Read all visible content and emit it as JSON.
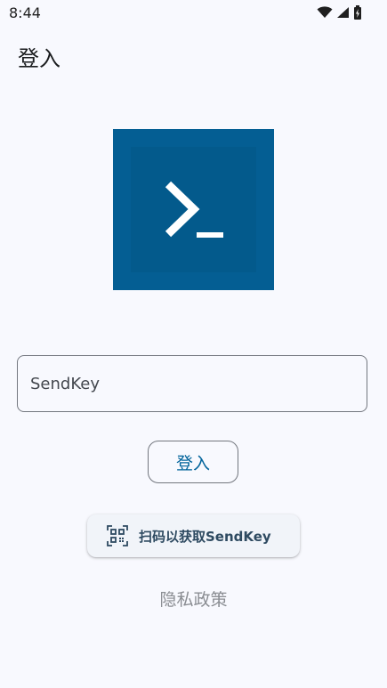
{
  "status_bar": {
    "time": "8:44",
    "icons": [
      "wifi-icon",
      "cellular-signal-icon",
      "battery-icon"
    ]
  },
  "app_bar": {
    "title": "登入"
  },
  "logo": {
    "icon": "terminal-prompt-icon",
    "color": "#045e93"
  },
  "form": {
    "sendkey_placeholder": "SendKey",
    "sendkey_value": "",
    "login_label": "登入",
    "scan_label": "扫码以获取SendKey",
    "scan_icon": "qr-code-scan-icon"
  },
  "footer": {
    "privacy_label": "隐私政策"
  },
  "colors": {
    "background": "#f8f9fe",
    "primary": "#00639b",
    "outline": "#73777f"
  }
}
